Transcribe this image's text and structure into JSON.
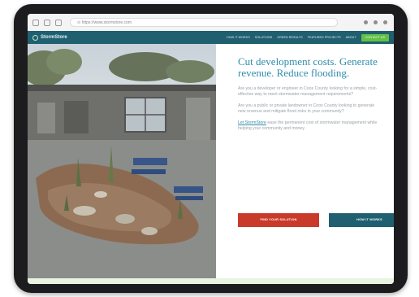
{
  "browser": {
    "url": "⊙  https://www.stormstore.com",
    "nav_icons": [
      "back-icon",
      "forward-icon",
      "refresh-icon"
    ],
    "tool_icons": [
      "star-icon",
      "extension-icon",
      "menu-dots-icon"
    ]
  },
  "site": {
    "logo_text": "StormStore",
    "menu": [
      "HOW IT WORKS",
      "SOLUTIONS",
      "GREEN RESULTS",
      "FEATURED PROJECTS",
      "ABOUT"
    ],
    "contact_label": "CONTACT US"
  },
  "hero": {
    "headline": "Cut development costs. Generate revenue. Reduce flooding.",
    "paragraph_1": "Are you a developer or engineer in Coos County looking for a simple, cost-effective way to meet stormwater management requirements?",
    "paragraph_2": "Are you a public or private landowner in Coos County looking to generate new revenue and mitigate flood risks in your community?",
    "paragraph_3_link": "Let StormStore",
    "paragraph_3_rest": " ease the permanent cost of stormwater management while helping your community and money.",
    "cta_primary": "FIND YOUR SOLUTION",
    "cta_secondary": "HOW IT WORKS"
  },
  "colors": {
    "nav": "#1f5f70",
    "accent": "#2f8dab",
    "cta_red": "#c93a2a",
    "contact_green": "#62c046"
  }
}
